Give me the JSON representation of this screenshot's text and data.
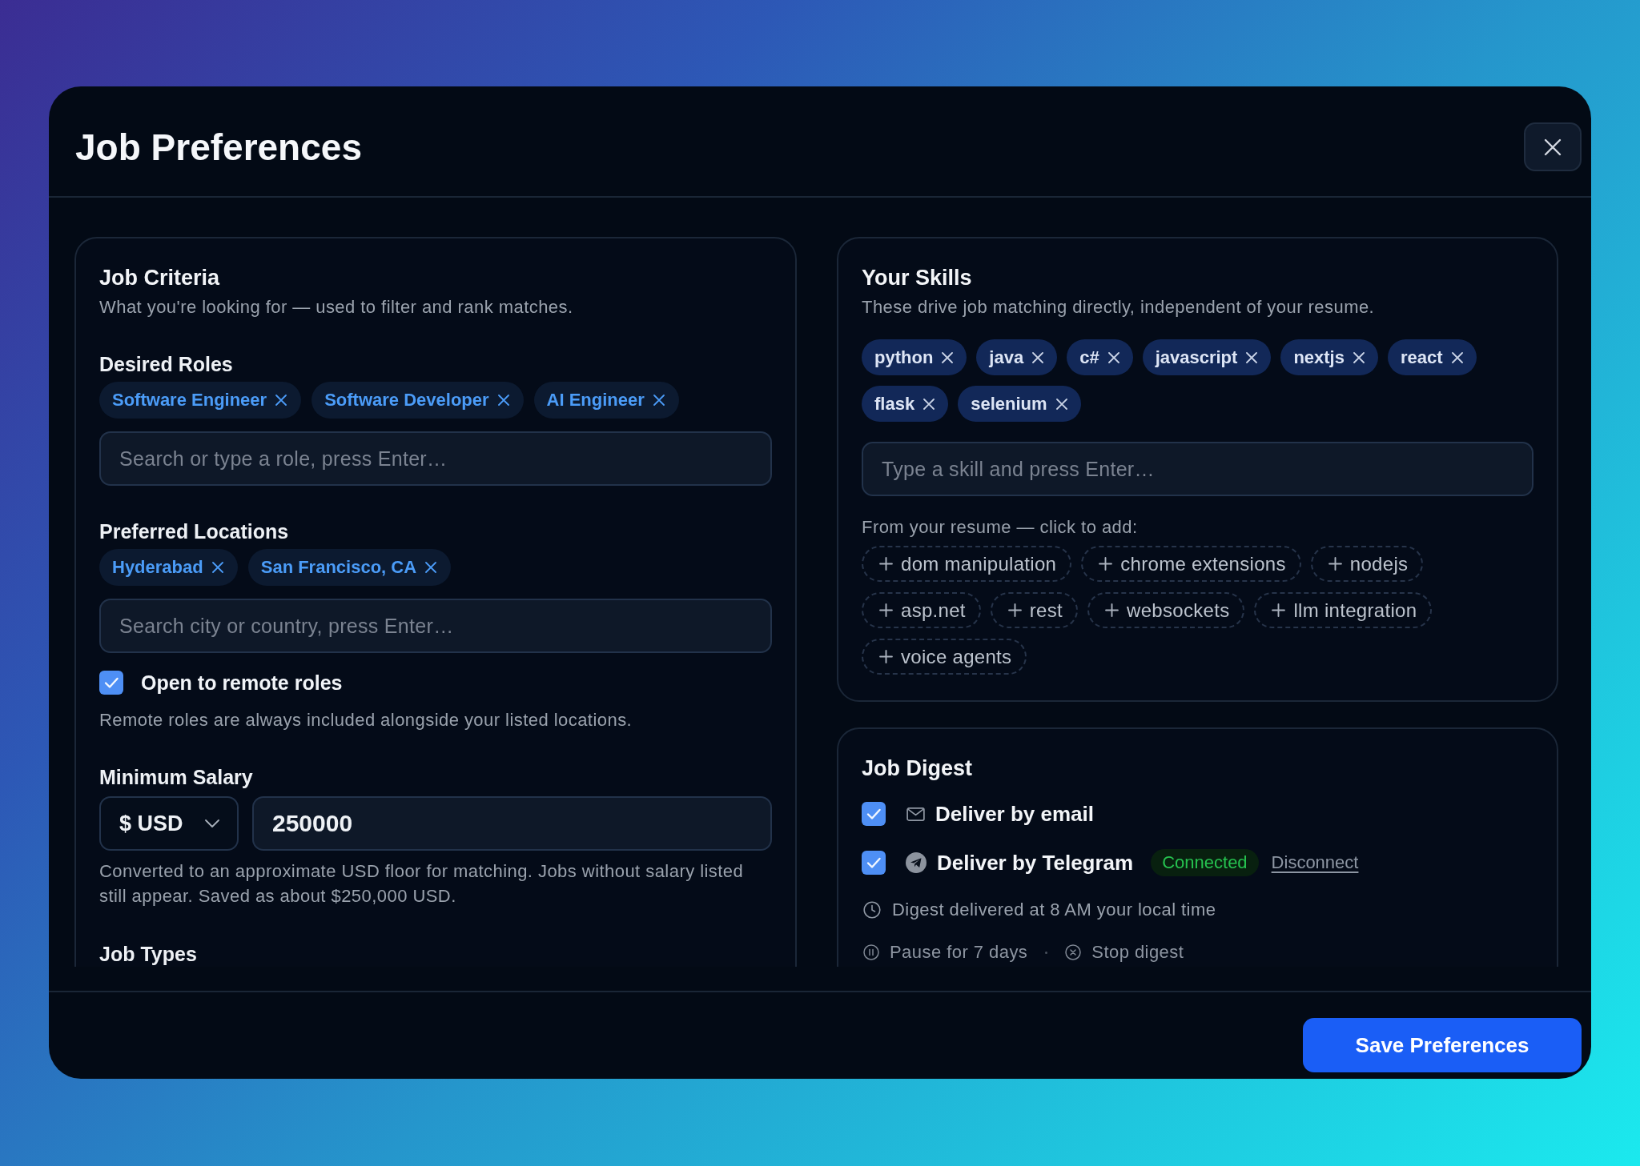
{
  "dialog": {
    "title": "Job Preferences"
  },
  "job_criteria": {
    "title": "Job Criteria",
    "subtitle": "What you're looking for — used to filter and rank matches.",
    "desired_roles": {
      "label": "Desired Roles",
      "chips": [
        "Software Engineer",
        "Software Developer",
        "AI Engineer"
      ],
      "placeholder": "Search or type a role, press Enter…"
    },
    "preferred_locations": {
      "label": "Preferred Locations",
      "chips": [
        "Hyderabad",
        "San Francisco, CA"
      ],
      "placeholder": "Search city or country, press Enter…"
    },
    "remote": {
      "label": "Open to remote roles",
      "checked": true,
      "help": "Remote roles are always included alongside your listed locations."
    },
    "minimum_salary": {
      "label": "Minimum Salary",
      "currency": "$ USD",
      "amount": "250000",
      "help": "Converted to an approximate USD floor for matching. Jobs without salary listed still appear. Saved as about $250,000 USD."
    },
    "job_types": {
      "label": "Job Types"
    }
  },
  "skills": {
    "title": "Your Skills",
    "subtitle": "These drive job matching directly, independent of your resume.",
    "chips": [
      "python",
      "java",
      "c#",
      "javascript",
      "nextjs",
      "react",
      "flask",
      "selenium"
    ],
    "placeholder": "Type a skill and press Enter…",
    "suggestions_label": "From your resume — click to add:",
    "suggestions": [
      "dom manipulation",
      "chrome extensions",
      "nodejs",
      "asp.net",
      "rest",
      "websockets",
      "llm integration",
      "voice agents"
    ]
  },
  "job_digest": {
    "title": "Job Digest",
    "channels": [
      {
        "kind": "email",
        "label": "Deliver by email",
        "checked": true
      },
      {
        "kind": "telegram",
        "label": "Deliver by Telegram",
        "checked": true,
        "status": "Connected",
        "action": "Disconnect"
      }
    ],
    "schedule": "Digest delivered at 8 AM your local time",
    "actions": [
      {
        "kind": "pause",
        "label": "Pause for 7 days"
      },
      {
        "kind": "stop",
        "label": "Stop digest"
      }
    ]
  },
  "footer": {
    "save_button": "Save Preferences"
  }
}
